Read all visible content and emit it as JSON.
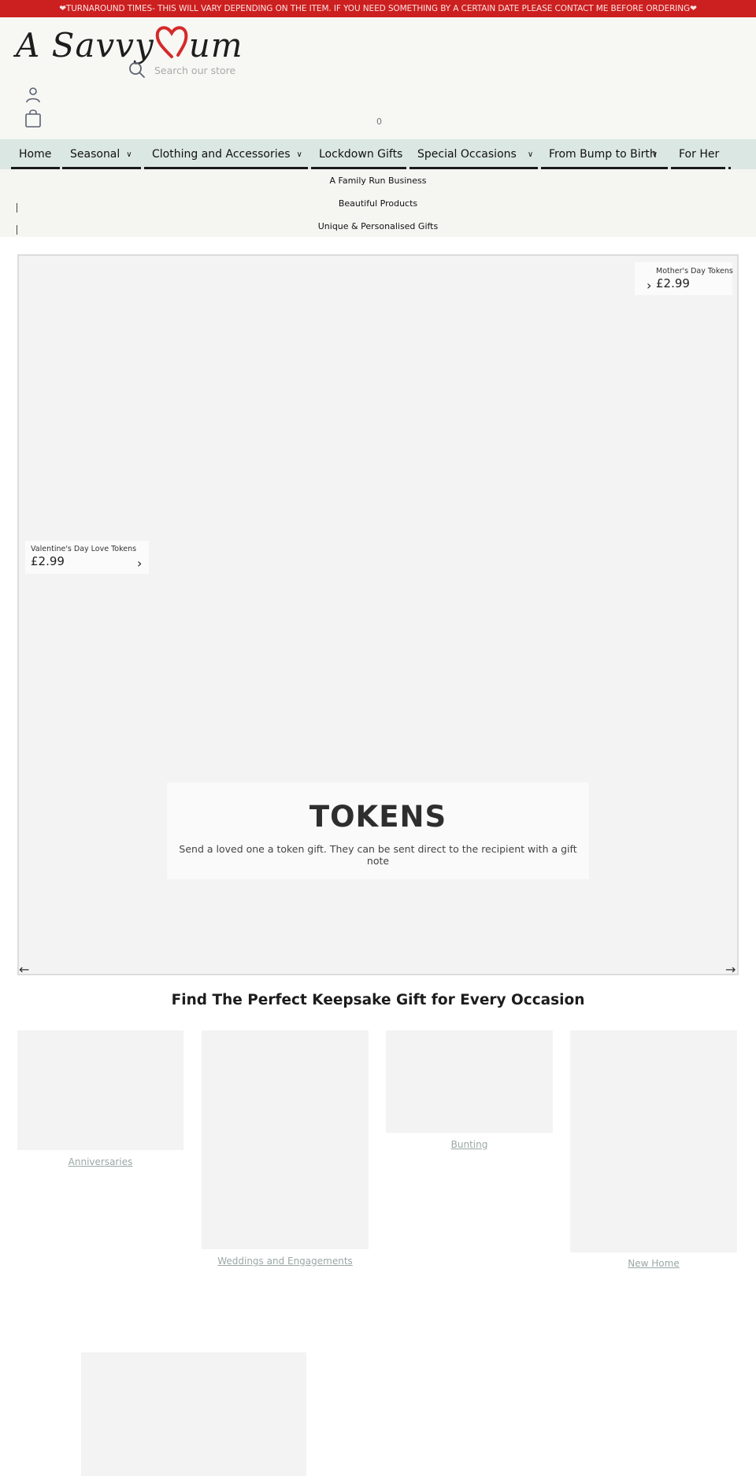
{
  "announcement": "❤TURNAROUND TIMES- THIS WILL VARY DEPENDING ON THE ITEM. IF YOU NEED SOMETHING BY A CERTAIN DATE PLEASE CONTACT ME BEFORE ORDERING❤",
  "header": {
    "logo_left": "A Savvy",
    "logo_right": "um",
    "search_placeholder": "Search our store",
    "cart_count": "0"
  },
  "nav": {
    "items": [
      {
        "label": "Home",
        "has_dropdown": false
      },
      {
        "label": "Seasonal",
        "has_dropdown": true
      },
      {
        "label": "Clothing and Accessories",
        "has_dropdown": true
      },
      {
        "label": "Lockdown Gifts",
        "has_dropdown": false
      },
      {
        "label": "Special Occasions",
        "has_dropdown": true
      },
      {
        "label": "From Bump to Birth",
        "has_dropdown": true
      },
      {
        "label": "For Her",
        "has_dropdown": false
      }
    ],
    "chevron": "∨"
  },
  "usps": [
    "A Family Run Business",
    "Beautiful Products",
    "Unique & Personalised Gifts"
  ],
  "slider": {
    "hotspots": [
      {
        "name": "Mother's Day Tokens",
        "price": "£2.99"
      },
      {
        "name": "Valentine's Day Love Tokens",
        "price": "£2.99"
      }
    ],
    "caption_title": "TOKENS",
    "caption_text": "Send a loved one a token gift. They can be sent direct to the recipient with a gift note",
    "prev_arrow": "←",
    "next_arrow": "→",
    "hotspot_arrow": "›"
  },
  "collections": {
    "title": "Find The Perfect Keepsake Gift for Every Occasion",
    "items": [
      {
        "label": "Anniversaries"
      },
      {
        "label": "Weddings and Engagements"
      },
      {
        "label": "Bunting"
      },
      {
        "label": "New Home"
      },
      {
        "label": ""
      }
    ]
  }
}
